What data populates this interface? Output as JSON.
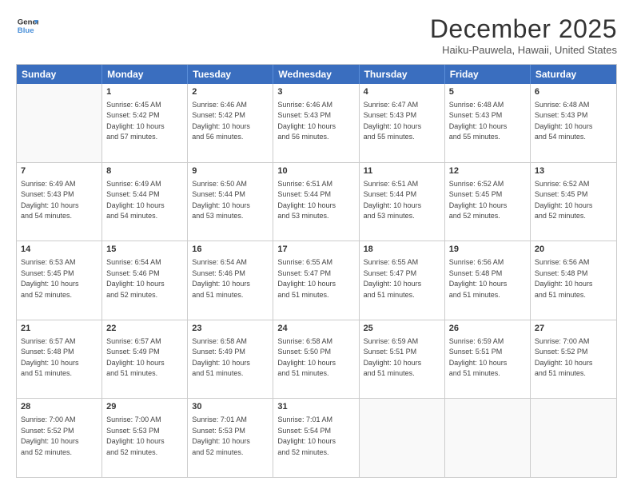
{
  "header": {
    "logo_line1": "General",
    "logo_line2": "Blue",
    "month_title": "December 2025",
    "location": "Haiku-Pauwela, Hawaii, United States"
  },
  "days_of_week": [
    "Sunday",
    "Monday",
    "Tuesday",
    "Wednesday",
    "Thursday",
    "Friday",
    "Saturday"
  ],
  "weeks": [
    [
      {
        "day": "",
        "sunrise": "",
        "sunset": "",
        "daylight": ""
      },
      {
        "day": "1",
        "sunrise": "Sunrise: 6:45 AM",
        "sunset": "Sunset: 5:42 PM",
        "daylight": "Daylight: 10 hours and 57 minutes."
      },
      {
        "day": "2",
        "sunrise": "Sunrise: 6:46 AM",
        "sunset": "Sunset: 5:42 PM",
        "daylight": "Daylight: 10 hours and 56 minutes."
      },
      {
        "day": "3",
        "sunrise": "Sunrise: 6:46 AM",
        "sunset": "Sunset: 5:43 PM",
        "daylight": "Daylight: 10 hours and 56 minutes."
      },
      {
        "day": "4",
        "sunrise": "Sunrise: 6:47 AM",
        "sunset": "Sunset: 5:43 PM",
        "daylight": "Daylight: 10 hours and 55 minutes."
      },
      {
        "day": "5",
        "sunrise": "Sunrise: 6:48 AM",
        "sunset": "Sunset: 5:43 PM",
        "daylight": "Daylight: 10 hours and 55 minutes."
      },
      {
        "day": "6",
        "sunrise": "Sunrise: 6:48 AM",
        "sunset": "Sunset: 5:43 PM",
        "daylight": "Daylight: 10 hours and 54 minutes."
      }
    ],
    [
      {
        "day": "7",
        "sunrise": "Sunrise: 6:49 AM",
        "sunset": "Sunset: 5:43 PM",
        "daylight": "Daylight: 10 hours and 54 minutes."
      },
      {
        "day": "8",
        "sunrise": "Sunrise: 6:49 AM",
        "sunset": "Sunset: 5:44 PM",
        "daylight": "Daylight: 10 hours and 54 minutes."
      },
      {
        "day": "9",
        "sunrise": "Sunrise: 6:50 AM",
        "sunset": "Sunset: 5:44 PM",
        "daylight": "Daylight: 10 hours and 53 minutes."
      },
      {
        "day": "10",
        "sunrise": "Sunrise: 6:51 AM",
        "sunset": "Sunset: 5:44 PM",
        "daylight": "Daylight: 10 hours and 53 minutes."
      },
      {
        "day": "11",
        "sunrise": "Sunrise: 6:51 AM",
        "sunset": "Sunset: 5:44 PM",
        "daylight": "Daylight: 10 hours and 53 minutes."
      },
      {
        "day": "12",
        "sunrise": "Sunrise: 6:52 AM",
        "sunset": "Sunset: 5:45 PM",
        "daylight": "Daylight: 10 hours and 52 minutes."
      },
      {
        "day": "13",
        "sunrise": "Sunrise: 6:52 AM",
        "sunset": "Sunset: 5:45 PM",
        "daylight": "Daylight: 10 hours and 52 minutes."
      }
    ],
    [
      {
        "day": "14",
        "sunrise": "Sunrise: 6:53 AM",
        "sunset": "Sunset: 5:45 PM",
        "daylight": "Daylight: 10 hours and 52 minutes."
      },
      {
        "day": "15",
        "sunrise": "Sunrise: 6:54 AM",
        "sunset": "Sunset: 5:46 PM",
        "daylight": "Daylight: 10 hours and 52 minutes."
      },
      {
        "day": "16",
        "sunrise": "Sunrise: 6:54 AM",
        "sunset": "Sunset: 5:46 PM",
        "daylight": "Daylight: 10 hours and 51 minutes."
      },
      {
        "day": "17",
        "sunrise": "Sunrise: 6:55 AM",
        "sunset": "Sunset: 5:47 PM",
        "daylight": "Daylight: 10 hours and 51 minutes."
      },
      {
        "day": "18",
        "sunrise": "Sunrise: 6:55 AM",
        "sunset": "Sunset: 5:47 PM",
        "daylight": "Daylight: 10 hours and 51 minutes."
      },
      {
        "day": "19",
        "sunrise": "Sunrise: 6:56 AM",
        "sunset": "Sunset: 5:48 PM",
        "daylight": "Daylight: 10 hours and 51 minutes."
      },
      {
        "day": "20",
        "sunrise": "Sunrise: 6:56 AM",
        "sunset": "Sunset: 5:48 PM",
        "daylight": "Daylight: 10 hours and 51 minutes."
      }
    ],
    [
      {
        "day": "21",
        "sunrise": "Sunrise: 6:57 AM",
        "sunset": "Sunset: 5:48 PM",
        "daylight": "Daylight: 10 hours and 51 minutes."
      },
      {
        "day": "22",
        "sunrise": "Sunrise: 6:57 AM",
        "sunset": "Sunset: 5:49 PM",
        "daylight": "Daylight: 10 hours and 51 minutes."
      },
      {
        "day": "23",
        "sunrise": "Sunrise: 6:58 AM",
        "sunset": "Sunset: 5:49 PM",
        "daylight": "Daylight: 10 hours and 51 minutes."
      },
      {
        "day": "24",
        "sunrise": "Sunrise: 6:58 AM",
        "sunset": "Sunset: 5:50 PM",
        "daylight": "Daylight: 10 hours and 51 minutes."
      },
      {
        "day": "25",
        "sunrise": "Sunrise: 6:59 AM",
        "sunset": "Sunset: 5:51 PM",
        "daylight": "Daylight: 10 hours and 51 minutes."
      },
      {
        "day": "26",
        "sunrise": "Sunrise: 6:59 AM",
        "sunset": "Sunset: 5:51 PM",
        "daylight": "Daylight: 10 hours and 51 minutes."
      },
      {
        "day": "27",
        "sunrise": "Sunrise: 7:00 AM",
        "sunset": "Sunset: 5:52 PM",
        "daylight": "Daylight: 10 hours and 51 minutes."
      }
    ],
    [
      {
        "day": "28",
        "sunrise": "Sunrise: 7:00 AM",
        "sunset": "Sunset: 5:52 PM",
        "daylight": "Daylight: 10 hours and 52 minutes."
      },
      {
        "day": "29",
        "sunrise": "Sunrise: 7:00 AM",
        "sunset": "Sunset: 5:53 PM",
        "daylight": "Daylight: 10 hours and 52 minutes."
      },
      {
        "day": "30",
        "sunrise": "Sunrise: 7:01 AM",
        "sunset": "Sunset: 5:53 PM",
        "daylight": "Daylight: 10 hours and 52 minutes."
      },
      {
        "day": "31",
        "sunrise": "Sunrise: 7:01 AM",
        "sunset": "Sunset: 5:54 PM",
        "daylight": "Daylight: 10 hours and 52 minutes."
      },
      {
        "day": "",
        "sunrise": "",
        "sunset": "",
        "daylight": ""
      },
      {
        "day": "",
        "sunrise": "",
        "sunset": "",
        "daylight": ""
      },
      {
        "day": "",
        "sunrise": "",
        "sunset": "",
        "daylight": ""
      }
    ]
  ]
}
